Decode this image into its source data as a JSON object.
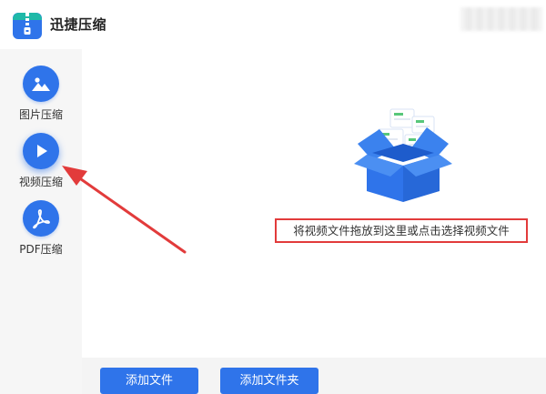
{
  "app": {
    "title": "迅捷压缩",
    "logo_icon": "zip-archive-icon",
    "accent_color": "#2f74ea"
  },
  "sidebar": {
    "items": [
      {
        "label": "图片压缩",
        "icon": "image-mountain-icon",
        "active": false
      },
      {
        "label": "视频压缩",
        "icon": "play-icon",
        "active": true
      },
      {
        "label": "PDF压缩",
        "icon": "pdf-icon",
        "active": false
      }
    ]
  },
  "main": {
    "illustration_icon": "open-box-icon",
    "drop_hint": "将视频文件拖放到这里或点击选择视频文件",
    "highlight_color": "#e23b3b"
  },
  "toolbar": {
    "add_file_label": "添加文件",
    "add_folder_label": "添加文件夹"
  },
  "annotation": {
    "arrow_color": "#e23b3b"
  }
}
